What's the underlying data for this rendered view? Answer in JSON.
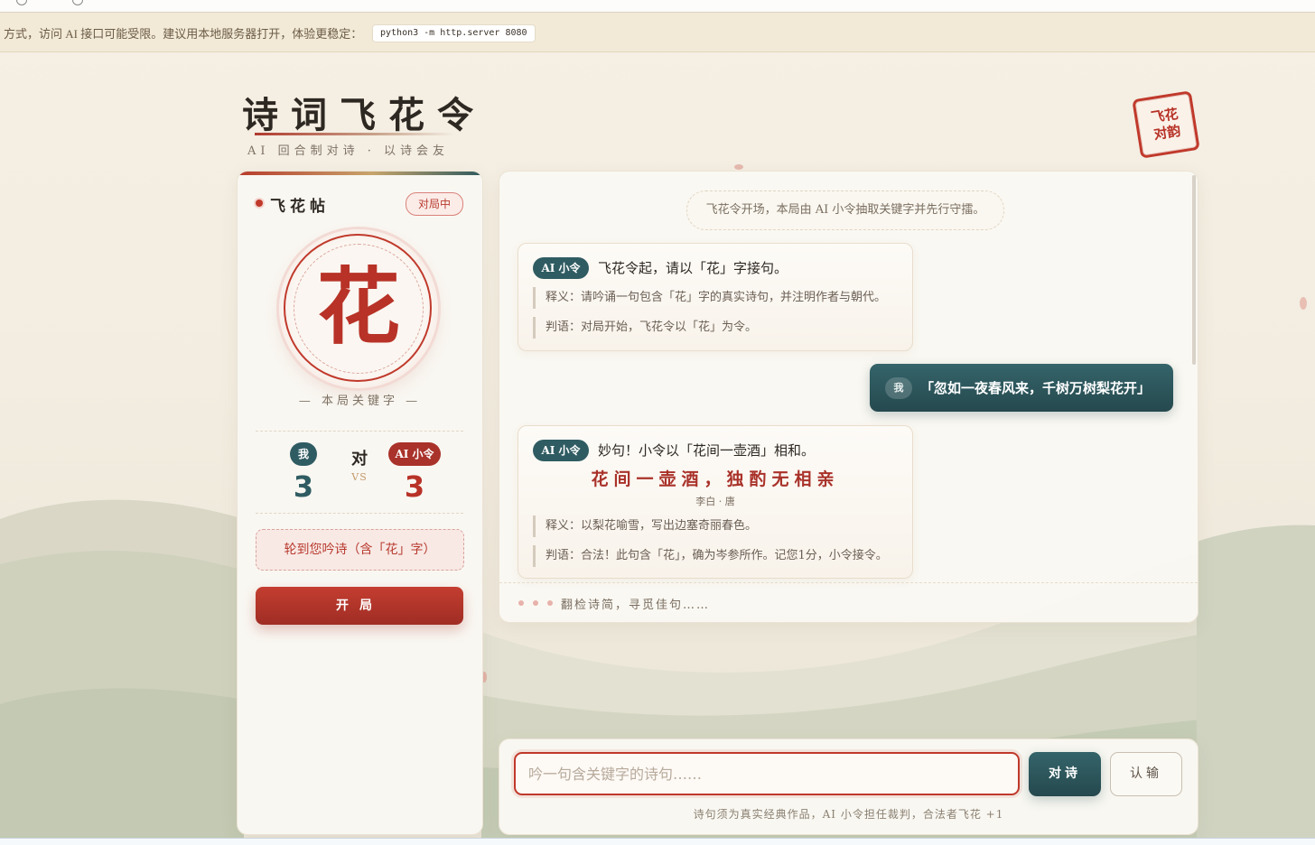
{
  "banner": {
    "text": "方式，访问 AI 接口可能受限。建议用本地服务器打开，体验更稳定：",
    "command": "python3 -m http.server 8080"
  },
  "header": {
    "title": "诗词飞花令",
    "subtitle": "AI 回合制对诗 · 以诗会友",
    "seal_line1": "飞花",
    "seal_line2": "对韵"
  },
  "sidebar": {
    "title": "飞花帖",
    "status": "对局中",
    "keyword": "花",
    "keyword_label": "— 本局关键字 —",
    "score": {
      "me_label": "我",
      "me_score": "3",
      "vs_char": "对",
      "vs_text": "VS",
      "ai_label": "AI 小令",
      "ai_score": "3"
    },
    "turn_prompt": "轮到您吟诗（含「花」字）",
    "start_button": "开局"
  },
  "chat": {
    "system_message": "飞花令开场，本局由 AI 小令抽取关键字并先行守擂。",
    "messages": [
      {
        "sender": "AI 小令",
        "text": "飞花令起，请以「花」字接句。",
        "notes": [
          "释义：请吟诵一句包含「花」字的真实诗句，并注明作者与朝代。",
          "判语：对局开始，飞花令以「花」为令。"
        ]
      },
      {
        "sender": "我",
        "text": "「忽如一夜春风来，千树万树梨花开」"
      },
      {
        "sender": "AI 小令",
        "text": "妙句！小令以「花间一壶酒」相和。",
        "poem": "花间一壶酒，独酌无相亲",
        "author": "李白 · 唐",
        "notes": [
          "释义：以梨花喻雪，写出边塞奇丽春色。",
          "判语：合法！此句含「花」，确为岑参所作。记您1分，小令接令。"
        ]
      }
    ],
    "typing": "翻检诗简，寻觅佳句……"
  },
  "composer": {
    "placeholder": "吟一句含关键字的诗句……",
    "send_button": "对诗",
    "concede_button": "认输",
    "hint": "诗句须为真实经典作品，AI 小令担任裁判，合法者飞花 +1"
  },
  "colors": {
    "accent_red": "#b83227",
    "accent_teal": "#2f5c62",
    "paper": "#f9f7f2"
  }
}
